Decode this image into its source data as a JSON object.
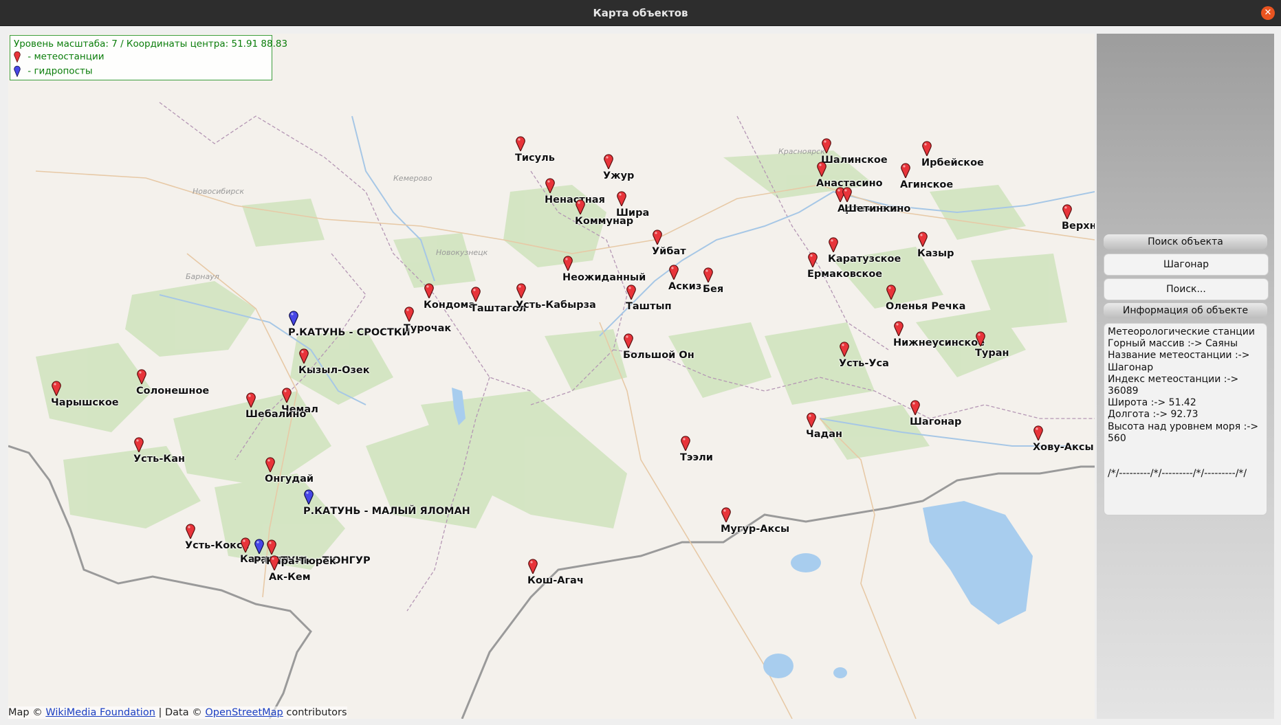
{
  "window": {
    "title": "Карта объектов"
  },
  "legend": {
    "scale_text": "Уровень масштаба: 7 / Координаты центра: 51.91  88.83",
    "items": [
      {
        "color": "#e8343a",
        "label": " - метеостанции"
      },
      {
        "color": "#4747e6",
        "label": " - гидропосты"
      }
    ]
  },
  "map_labels": [
    "Новосибирск",
    "Кемерово",
    "Новокузнецк",
    "Барнаул",
    "Красноярск"
  ],
  "markers": [
    {
      "name": "Тисуль",
      "type": "meteo"
    },
    {
      "name": "Ужур",
      "type": "meteo"
    },
    {
      "name": "Ненастная",
      "type": "meteo"
    },
    {
      "name": "Шира",
      "type": "meteo"
    },
    {
      "name": "Коммунар",
      "type": "meteo"
    },
    {
      "name": "Шалинское",
      "type": "meteo"
    },
    {
      "name": "Ирбейское",
      "type": "meteo"
    },
    {
      "name": "Анастасино",
      "type": "meteo"
    },
    {
      "name": "Агинское",
      "type": "meteo"
    },
    {
      "name": "Артемовск",
      "type": "meteo"
    },
    {
      "name": "Шетинкино",
      "type": "meteo"
    },
    {
      "name": "Верхн",
      "type": "meteo"
    },
    {
      "name": "Уйбат",
      "type": "meteo"
    },
    {
      "name": "Каратузское",
      "type": "meteo"
    },
    {
      "name": "Казыр",
      "type": "meteo"
    },
    {
      "name": "Ермаковское",
      "type": "meteo"
    },
    {
      "name": "Неожиданный",
      "type": "meteo"
    },
    {
      "name": "Аскиз",
      "type": "meteo"
    },
    {
      "name": "Бея",
      "type": "meteo"
    },
    {
      "name": "Кондома",
      "type": "meteo"
    },
    {
      "name": "Таштагол",
      "type": "meteo"
    },
    {
      "name": "Усть-Кабырза",
      "type": "meteo"
    },
    {
      "name": "Таштып",
      "type": "meteo"
    },
    {
      "name": "Оленья Речка",
      "type": "meteo"
    },
    {
      "name": "Р.КАТУНЬ - СРОСТКИ",
      "type": "hydro"
    },
    {
      "name": "Турочак",
      "type": "meteo"
    },
    {
      "name": "Нижнеусинское",
      "type": "meteo"
    },
    {
      "name": "Туран",
      "type": "meteo"
    },
    {
      "name": "Большой Он",
      "type": "meteo"
    },
    {
      "name": "Усть-Уса",
      "type": "meteo"
    },
    {
      "name": "Кызыл-Озек",
      "type": "meteo"
    },
    {
      "name": "Солонешное",
      "type": "meteo"
    },
    {
      "name": "Чарышское",
      "type": "meteo"
    },
    {
      "name": "Чемал",
      "type": "meteo"
    },
    {
      "name": "Шебалино",
      "type": "meteo"
    },
    {
      "name": "Шагонар",
      "type": "meteo"
    },
    {
      "name": "Чадан",
      "type": "meteo"
    },
    {
      "name": "Хову-Аксы",
      "type": "meteo"
    },
    {
      "name": "Тээли",
      "type": "meteo"
    },
    {
      "name": "Усть-Кан",
      "type": "meteo"
    },
    {
      "name": "Онгудай",
      "type": "meteo"
    },
    {
      "name": "Р.КАТУНЬ - МАЛЫЙ ЯЛОМАН",
      "type": "hydro"
    },
    {
      "name": "Мугур-Аксы",
      "type": "meteo"
    },
    {
      "name": "Усть-Кокса",
      "type": "meteo"
    },
    {
      "name": "Катанда",
      "type": "meteo"
    },
    {
      "name": "Р.КАТУНЬ - ТЮНГУР",
      "type": "hydro"
    },
    {
      "name": "Кара-Тюрек",
      "type": "meteo"
    },
    {
      "name": "Ак-Кем",
      "type": "meteo"
    },
    {
      "name": "Кош-Агач",
      "type": "meteo"
    }
  ],
  "attribution": {
    "prefix": "Map © ",
    "link1": "WikiMedia Foundation",
    "middle": " | Data © ",
    "link2": "OpenStreetMap",
    "suffix": " contributors"
  },
  "panel": {
    "search_title": "Поиск объекта",
    "search_value": "Шагонар",
    "search_button": "Поиск...",
    "info_title": "Информация об объекте",
    "info_lines": [
      "Метеорологические станции",
      "Горный массив :-> Саяны",
      "Название метеостанции :->",
      "Шагонар",
      "Индекс метеостанции :-> 36089",
      "Широта :-> 51.42",
      "Долгота :-> 92.73",
      "Высота над уровнем моря :->",
      "560",
      "",
      "",
      "/*/---------/*/---------/*/---------/*/"
    ]
  }
}
